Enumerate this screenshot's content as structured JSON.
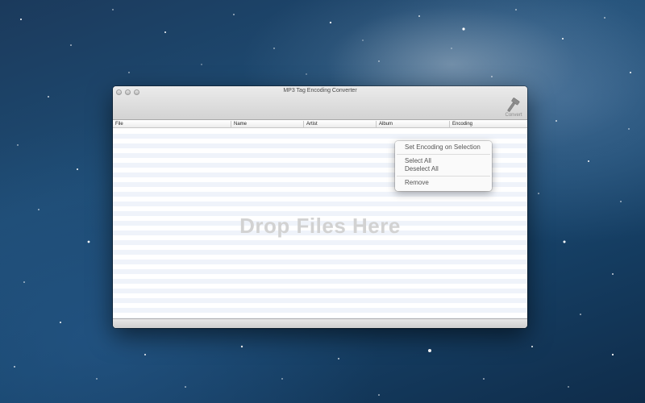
{
  "window": {
    "title": "MP3 Tag Encoding Converter"
  },
  "toolbar": {
    "convert_label": "Convert",
    "convert_icon": "hammer-icon"
  },
  "table": {
    "columns": [
      "File",
      "Name",
      "Artist",
      "Album",
      "Encoding"
    ],
    "placeholder": "Drop Files Here"
  },
  "context_menu": {
    "items": [
      "Set Encoding on Selection",
      "Select All",
      "Deselect All",
      "Remove"
    ]
  }
}
